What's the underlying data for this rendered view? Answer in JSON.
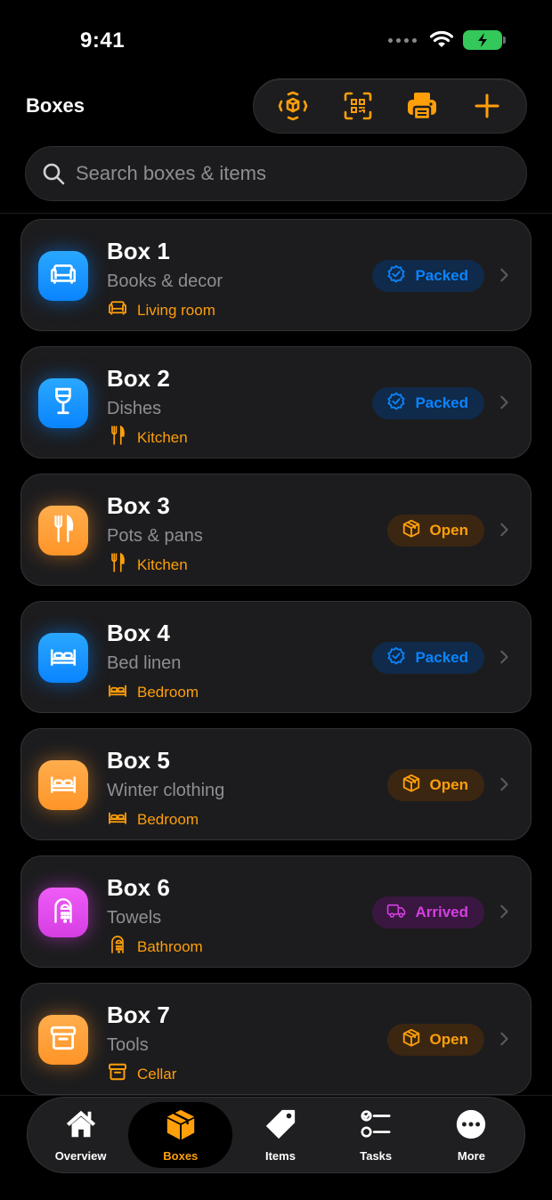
{
  "status": {
    "time": "9:41"
  },
  "header": {
    "title": "Boxes"
  },
  "toolbar": {
    "buttons": [
      {
        "icon": "ar-scan-icon"
      },
      {
        "icon": "qr-code-icon"
      },
      {
        "icon": "printer-icon"
      },
      {
        "icon": "plus-icon"
      }
    ]
  },
  "search": {
    "placeholder": "Search boxes & items",
    "value": ""
  },
  "boxes": [
    {
      "title": "Box 1",
      "subtitle": "Books & decor",
      "room": "Living room",
      "room_icon": "sofa-icon",
      "icon": "sofa-icon",
      "color": "blue",
      "status": "Packed"
    },
    {
      "title": "Box 2",
      "subtitle": "Dishes",
      "room": "Kitchen",
      "room_icon": "fork-knife-icon",
      "icon": "wineglass-icon",
      "color": "blue",
      "status": "Packed"
    },
    {
      "title": "Box 3",
      "subtitle": "Pots & pans",
      "room": "Kitchen",
      "room_icon": "fork-knife-icon",
      "icon": "fork-knife-icon",
      "color": "orange",
      "status": "Open"
    },
    {
      "title": "Box 4",
      "subtitle": "Bed linen",
      "room": "Bedroom",
      "room_icon": "bed-icon",
      "icon": "bed-icon",
      "color": "blue",
      "status": "Packed"
    },
    {
      "title": "Box 5",
      "subtitle": "Winter clothing",
      "room": "Bedroom",
      "room_icon": "bed-icon",
      "icon": "bed-icon",
      "color": "orange",
      "status": "Open"
    },
    {
      "title": "Box 6",
      "subtitle": "Towels",
      "room": "Bathroom",
      "room_icon": "shower-icon",
      "icon": "shower-icon",
      "color": "pink",
      "status": "Arrived"
    },
    {
      "title": "Box 7",
      "subtitle": "Tools",
      "room": "Cellar",
      "room_icon": "archive-box-icon",
      "icon": "archive-box-icon",
      "color": "orange",
      "status": "Open"
    }
  ],
  "tabs": [
    {
      "label": "Overview",
      "icon": "house-icon",
      "active": false
    },
    {
      "label": "Boxes",
      "icon": "shipping-box-icon",
      "active": true
    },
    {
      "label": "Items",
      "icon": "tag-icon",
      "active": false
    },
    {
      "label": "Tasks",
      "icon": "checklist-icon",
      "active": false
    },
    {
      "label": "More",
      "icon": "ellipsis-circle-icon",
      "active": false
    }
  ],
  "colors": {
    "blue": "#0a84ff",
    "orange": "#ff9f0a",
    "pink": "#d63ee3",
    "green": "#34c759"
  }
}
